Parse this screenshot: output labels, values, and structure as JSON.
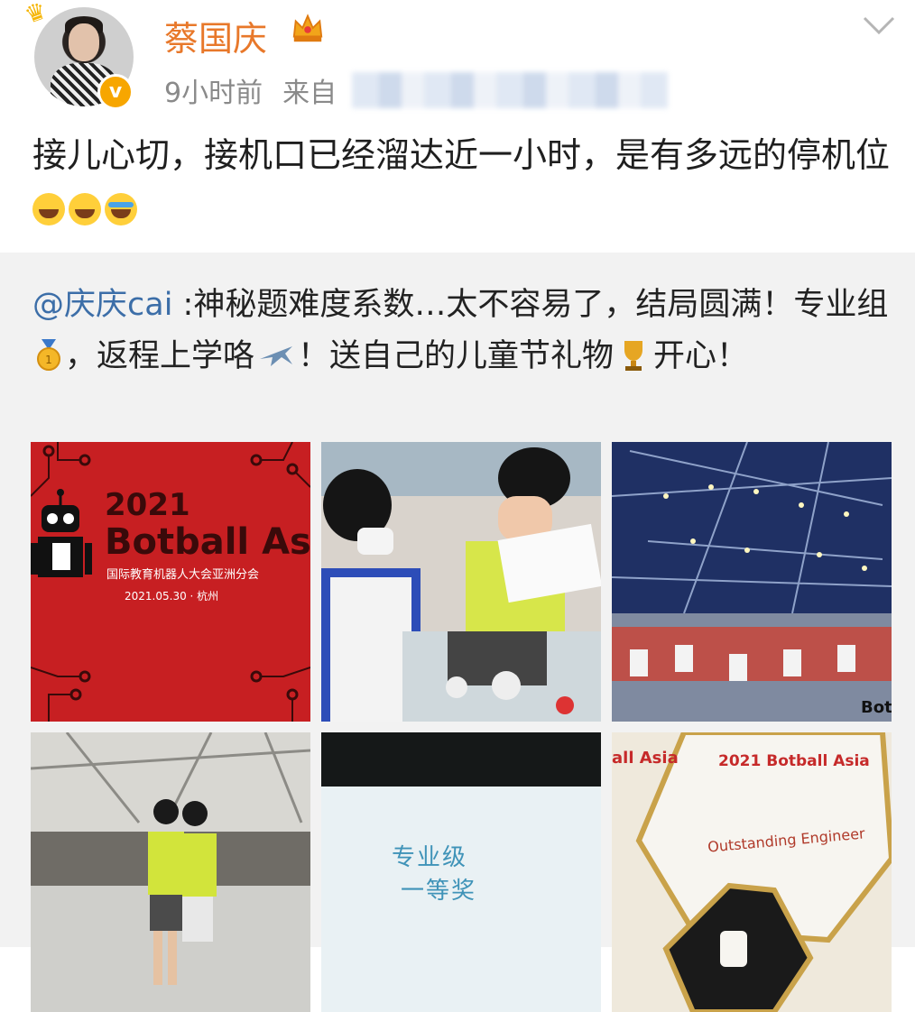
{
  "author": {
    "name": "蔡国庆",
    "time": "9小时前",
    "source_prefix": "来自"
  },
  "post": {
    "text": "接儿心切，接机口已经溜达近一小时，是有多远的停机位"
  },
  "repost": {
    "mention": "@庆庆cai",
    "text_part1": " :神秘题难度系数…太不容易了，结局圆满！专业组",
    "text_part2": "，返程上学咯",
    "text_part3": "！送自己的儿童节礼物",
    "text_part4": "开心！"
  },
  "images": {
    "img1": {
      "line1": "2021",
      "line2": "Botball Asi",
      "line3": "国际教育机器人大会亚洲分会",
      "line4": "2021.05.30 · 杭州"
    },
    "img5": {
      "line1": "专业级",
      "line2": "一等奖"
    },
    "img6": {
      "line1": "2021 Botball Asia",
      "line2": "Outstanding Engineer",
      "line3": "all Asia"
    },
    "img3": {
      "watermark": "Bot"
    }
  },
  "colors": {
    "username": "#e8782a",
    "mention": "#3c6ea8",
    "badge": "#f7a600"
  }
}
